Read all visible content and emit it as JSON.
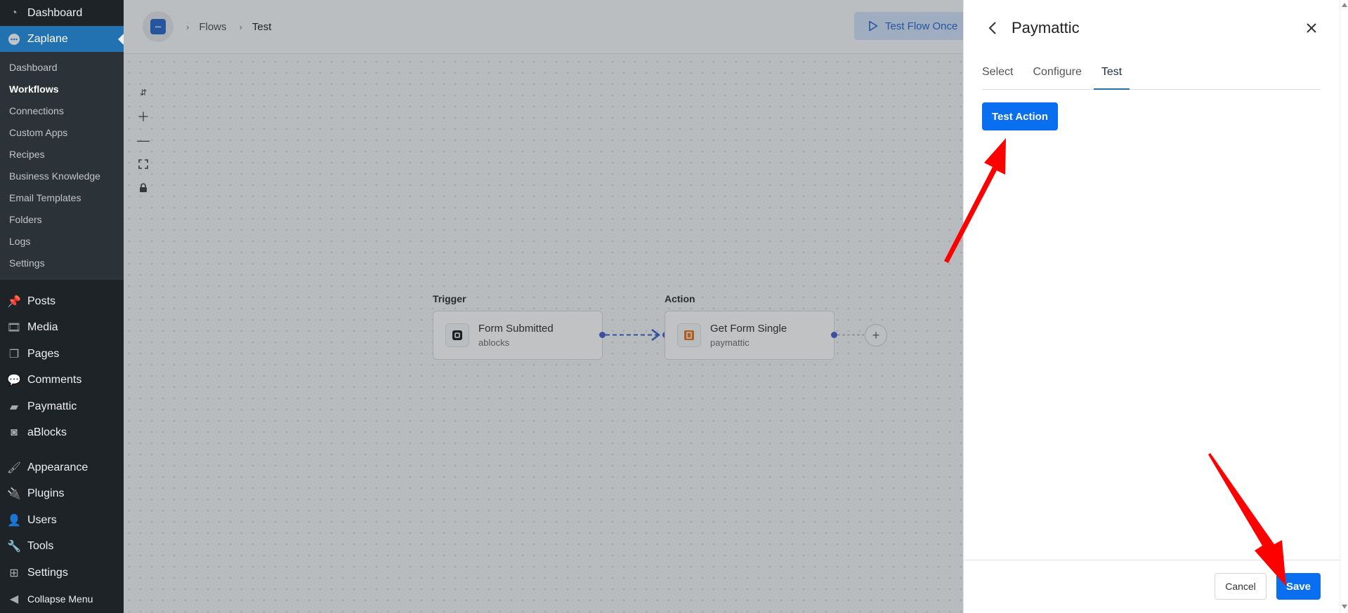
{
  "sidebar": {
    "top": [
      {
        "label": "Dashboard",
        "icon": "dashboard-icon"
      },
      {
        "label": "Zaplane",
        "icon": "zaplane-icon",
        "active": true
      }
    ],
    "submenu": [
      "Dashboard",
      "Workflows",
      "Connections",
      "Custom Apps",
      "Recipes",
      "Business Knowledge",
      "Email Templates",
      "Folders",
      "Logs",
      "Settings"
    ],
    "current_submenu": "Workflows",
    "group1": [
      {
        "label": "Posts",
        "icon": "pin-icon"
      },
      {
        "label": "Media",
        "icon": "media-icon"
      },
      {
        "label": "Pages",
        "icon": "pages-icon"
      },
      {
        "label": "Comments",
        "icon": "comment-icon"
      },
      {
        "label": "Paymattic",
        "icon": "paymattic-icon"
      },
      {
        "label": "aBlocks",
        "icon": "ablocks-icon"
      }
    ],
    "group2": [
      {
        "label": "Appearance",
        "icon": "brush-icon"
      },
      {
        "label": "Plugins",
        "icon": "plug-icon"
      },
      {
        "label": "Users",
        "icon": "user-icon"
      },
      {
        "label": "Tools",
        "icon": "wrench-icon"
      },
      {
        "label": "Settings",
        "icon": "settings-icon"
      },
      {
        "label": "Collapse Menu",
        "icon": "collapse-icon"
      }
    ]
  },
  "breadcrumb": {
    "flows": "Flows",
    "current": "Test"
  },
  "toolbar": {
    "test_flow_label": "Test Flow Once"
  },
  "flow": {
    "trigger": {
      "heading": "Trigger",
      "title": "Form Submitted",
      "app": "ablocks"
    },
    "action": {
      "heading": "Action",
      "title": "Get Form Single",
      "app": "paymattic"
    }
  },
  "panel": {
    "title": "Paymattic",
    "tabs": [
      "Select",
      "Configure",
      "Test"
    ],
    "active_tab": "Test",
    "test_action_label": "Test Action",
    "cancel_label": "Cancel",
    "save_label": "Save"
  },
  "colors": {
    "accent": "#0a6ef0",
    "sidebar_bg": "#1d2327",
    "active_menu": "#2271b1",
    "annotation": "#ff0000"
  }
}
